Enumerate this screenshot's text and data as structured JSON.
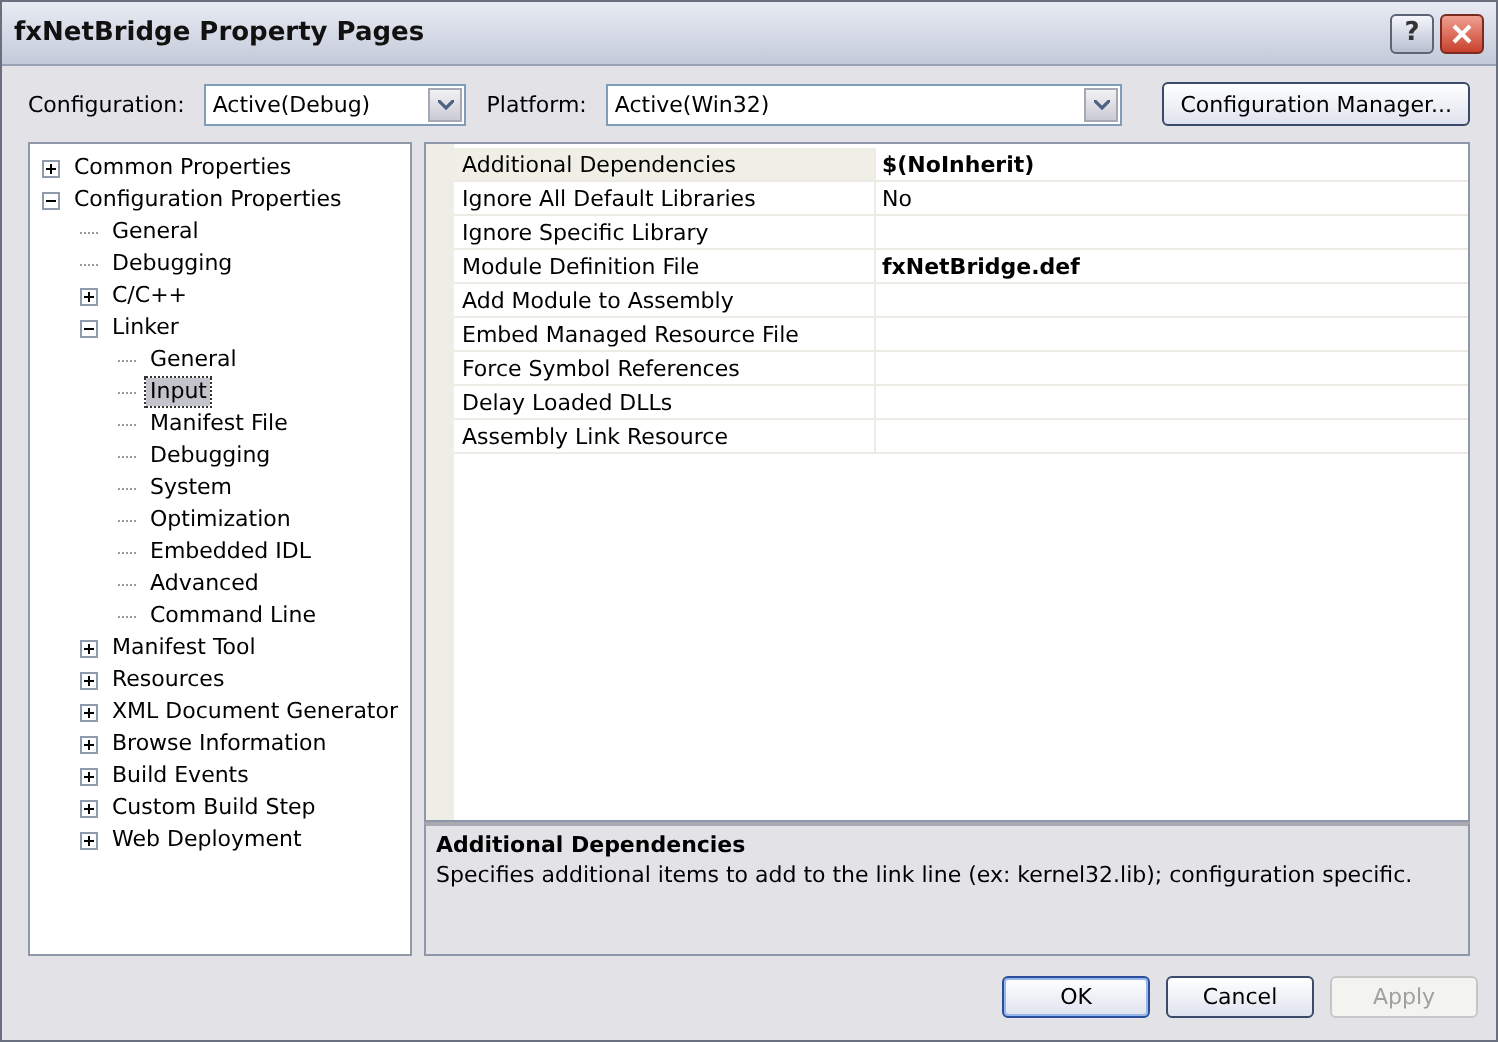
{
  "window": {
    "title": "fxNetBridge Property Pages",
    "help_button": "?"
  },
  "toolbar": {
    "configuration": {
      "label": "Configuration:",
      "value": "Active(Debug)"
    },
    "platform": {
      "label": "Platform:",
      "value": "Active(Win32)"
    },
    "manager_button": "Configuration Manager..."
  },
  "tree": [
    {
      "label": "Common Properties",
      "expanded": false,
      "selected": false
    },
    {
      "label": "Configuration Properties",
      "expanded": true,
      "selected": false,
      "children": [
        {
          "label": "General",
          "selected": false
        },
        {
          "label": "Debugging",
          "selected": false
        },
        {
          "label": "C/C++",
          "expanded": false,
          "selected": false
        },
        {
          "label": "Linker",
          "expanded": true,
          "selected": false,
          "children": [
            {
              "label": "General",
              "selected": false
            },
            {
              "label": "Input",
              "selected": true
            },
            {
              "label": "Manifest File",
              "selected": false
            },
            {
              "label": "Debugging",
              "selected": false
            },
            {
              "label": "System",
              "selected": false
            },
            {
              "label": "Optimization",
              "selected": false
            },
            {
              "label": "Embedded IDL",
              "selected": false
            },
            {
              "label": "Advanced",
              "selected": false
            },
            {
              "label": "Command Line",
              "selected": false
            }
          ]
        },
        {
          "label": "Manifest Tool",
          "expanded": false,
          "selected": false
        },
        {
          "label": "Resources",
          "expanded": false,
          "selected": false
        },
        {
          "label": "XML Document Generator",
          "expanded": false,
          "selected": false
        },
        {
          "label": "Browse Information",
          "expanded": false,
          "selected": false
        },
        {
          "label": "Build Events",
          "expanded": false,
          "selected": false
        },
        {
          "label": "Custom Build Step",
          "expanded": false,
          "selected": false
        },
        {
          "label": "Web Deployment",
          "expanded": false,
          "selected": false
        }
      ]
    }
  ],
  "properties": [
    {
      "name": "Additional Dependencies",
      "value": "$(NoInherit)",
      "modified": true,
      "selected": true
    },
    {
      "name": "Ignore All Default Libraries",
      "value": "No",
      "modified": false,
      "selected": false
    },
    {
      "name": "Ignore Specific Library",
      "selected": false
    },
    {
      "name": "Module Definition File",
      "value": "fxNetBridge.def",
      "modified": true,
      "selected": false
    },
    {
      "name": "Add Module to Assembly",
      "selected": false
    },
    {
      "name": "Embed Managed Resource File",
      "selected": false
    },
    {
      "name": "Force Symbol References",
      "selected": false
    },
    {
      "name": "Delay Loaded DLLs",
      "selected": false
    },
    {
      "name": "Assembly Link Resource",
      "selected": false
    }
  ],
  "description": {
    "title": "Additional Dependencies",
    "text": "Specifies additional items to add to the link line (ex: kernel32.lib); configuration specific."
  },
  "buttons": [
    {
      "label": "OK",
      "disabled": false,
      "default": true
    },
    {
      "label": "Cancel",
      "disabled": false,
      "default": false
    },
    {
      "label": "Apply",
      "disabled": true,
      "default": false
    }
  ]
}
